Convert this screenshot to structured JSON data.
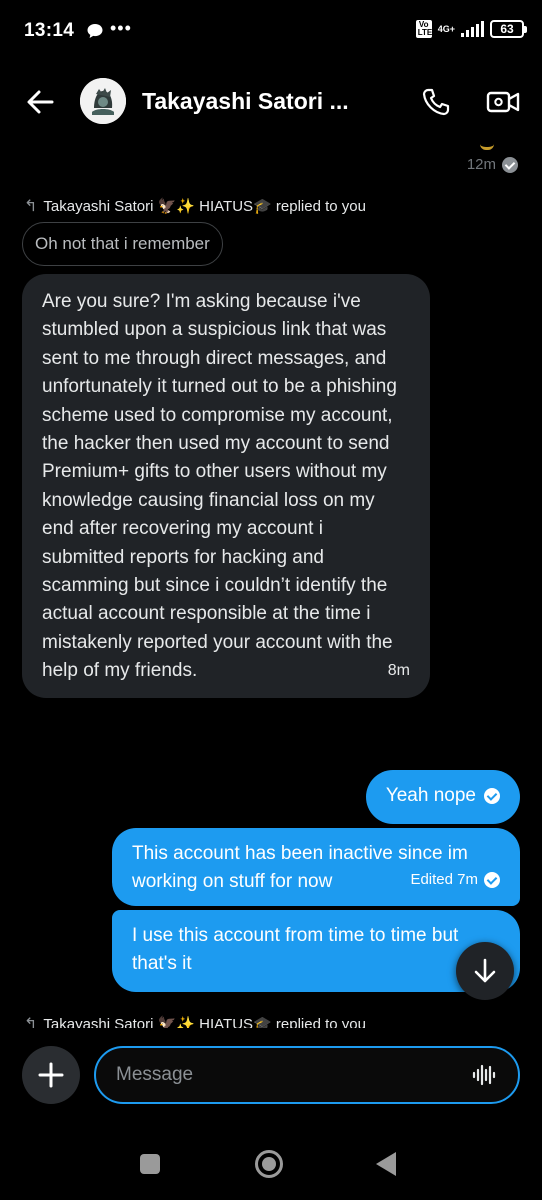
{
  "status_bar": {
    "time": "13:14",
    "more": "•••",
    "volte": "Vo LTE",
    "network": "4G+",
    "battery": "63"
  },
  "header": {
    "title": "Takayashi Satori ..."
  },
  "chat": {
    "prev_message_time": "12m",
    "reply_header_1": "Takayashi Satori 🦅✨ HIATUS🎓 replied to you",
    "quoted_text": "Oh not that i remember",
    "incoming": {
      "text": "Are you sure? I'm asking because i've stumbled upon a suspicious link that was sent to me through direct messages, and unfortunately it turned out to be a phishing scheme used to compromise my account, the hacker then used my account to send Premium+ gifts to other users without my knowledge causing financial loss on my end after recovering my account i submitted reports for hacking and scamming but since i couldn’t identify the actual account responsible at the time i mistakenly reported your account with the help of my friends.",
      "time": "8m"
    },
    "outgoing": [
      {
        "text": "Yeah nope"
      },
      {
        "text": "This account has been inactive since im working on stuff for now",
        "edited": "Edited 7m"
      },
      {
        "text": "I use this account from time to time but that's it"
      }
    ],
    "reply_header_2": "Takayashi Satori 🦅✨ HIATUS🎓 replied to you"
  },
  "composer": {
    "placeholder": "Message"
  },
  "colors": {
    "accent": "#1d9bf0",
    "incoming_bubble": "#202327",
    "background": "#000000"
  },
  "icons": {
    "back": "arrow-left-icon",
    "call": "phone-icon",
    "video": "video-camera-icon",
    "add": "plus-icon",
    "voice": "waveform-icon",
    "scroll": "arrow-down-icon"
  }
}
